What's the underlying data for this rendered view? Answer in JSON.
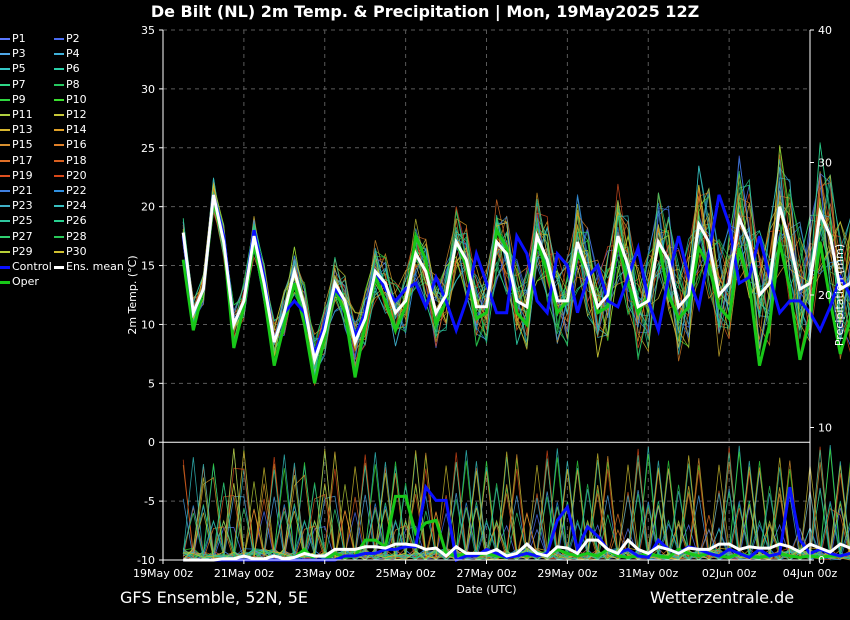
{
  "title": "De Bilt  (NL)  2m Temp. & Precipitation | Mon, 19May2025 12Z",
  "footer_left": "GFS Ensemble, 52N, 5E",
  "footer_right": "Wetterzentrale.de",
  "legend": {
    "members": [
      "P1",
      "P2",
      "P3",
      "P4",
      "P5",
      "P6",
      "P7",
      "P8",
      "P9",
      "P10",
      "P11",
      "P12",
      "P13",
      "P14",
      "P15",
      "P16",
      "P17",
      "P18",
      "P19",
      "P20",
      "P21",
      "P22",
      "P23",
      "P24",
      "P25",
      "P26",
      "P27",
      "P28",
      "P29",
      "P30"
    ],
    "member_colors": [
      "#5a78ff",
      "#4a6cf0",
      "#4fa8e8",
      "#3fb0d8",
      "#35c8c8",
      "#2ad0a8",
      "#2fd888",
      "#26c860",
      "#30d840",
      "#3ce030",
      "#b0d040",
      "#c8c838",
      "#d8b830",
      "#e0a028",
      "#d89030",
      "#e08028",
      "#e07028",
      "#d86020",
      "#e05020",
      "#d84818",
      "#4080e0",
      "#3090e0",
      "#40b0c8",
      "#38c0c0",
      "#30c8a0",
      "#28d090",
      "#30d070",
      "#28c858",
      "#b8d038",
      "#d0c030"
    ],
    "control": "Control",
    "ens_mean": "Ens. mean",
    "oper": "Oper"
  },
  "colors": {
    "control": "#0a10ff",
    "ens_mean": "#ffffff",
    "oper": "#18c818",
    "grid": "#5a5a5a"
  },
  "chart_data": {
    "type": "line",
    "xlabel": "Date (UTC)",
    "ylabel_left": "2m Temp. (°C)",
    "ylabel_right": "Precipitation (mm)",
    "x_ticks": [
      "19May 00z",
      "21May 00z",
      "23May 00z",
      "25May 00z",
      "27May 00z",
      "29May 00z",
      "31May 00z",
      "02Jun 00z",
      "04Jun 00z"
    ],
    "x_range_days": [
      0,
      16
    ],
    "x_start_offset_days": 0.5,
    "step_days": 0.25,
    "ylim_temp": [
      -10,
      35
    ],
    "yticks_temp": [
      -10,
      -5,
      0,
      5,
      10,
      15,
      20,
      25,
      30,
      35
    ],
    "ylim_precip": [
      0,
      40
    ],
    "yticks_precip": [
      0,
      10,
      20,
      30,
      40
    ],
    "grid": true,
    "temp_series": [
      {
        "name": "Control",
        "values": [
          17.5,
          11.0,
          13.0,
          21.0,
          17.5,
          10.0,
          12.0,
          18.0,
          14.0,
          8.5,
          11.0,
          12.0,
          11.0,
          7.5,
          10.0,
          13.0,
          12.0,
          9.0,
          11.0,
          14.5,
          13.0,
          12.0,
          13.0,
          13.5,
          11.5,
          14.0,
          12.0,
          9.5,
          12.0,
          16.0,
          13.5,
          11.0,
          11.0,
          17.5,
          16.0,
          12.0,
          11.0,
          16.0,
          15.0,
          11.0,
          14.0,
          15.0,
          12.0,
          11.5,
          14.0,
          16.5,
          12.0,
          9.5,
          14.0,
          17.5,
          14.0,
          11.5,
          16.0,
          21.0,
          18.5,
          13.5,
          14.0,
          17.5,
          14.0,
          11.0,
          12.0,
          12.0,
          11.0,
          9.5,
          11.5,
          14.0,
          12.5,
          8.0,
          11.0,
          19.0
        ]
      },
      {
        "name": "Ens. mean",
        "values": [
          17.8,
          11.0,
          13.0,
          21.0,
          17.0,
          10.0,
          12.0,
          17.5,
          13.5,
          8.5,
          11.0,
          14.5,
          11.5,
          7.0,
          9.5,
          13.5,
          12.0,
          8.5,
          10.5,
          14.5,
          13.5,
          11.0,
          12.0,
          16.0,
          14.5,
          11.0,
          12.5,
          17.0,
          15.5,
          11.5,
          11.5,
          17.0,
          16.0,
          12.0,
          11.5,
          17.5,
          15.5,
          12.0,
          12.0,
          17.0,
          14.5,
          11.5,
          12.5,
          17.5,
          15.0,
          11.5,
          12.0,
          17.0,
          15.5,
          11.5,
          12.5,
          18.5,
          17.0,
          12.5,
          13.5,
          19.0,
          17.0,
          12.5,
          13.5,
          20.0,
          17.0,
          13.0,
          13.5,
          19.5,
          17.5,
          13.0,
          13.5,
          20.0,
          18.5,
          13.5
        ]
      },
      {
        "name": "Oper",
        "values": [
          15.5,
          9.5,
          13.0,
          20.5,
          17.0,
          8.0,
          11.5,
          17.0,
          12.5,
          6.5,
          10.0,
          13.5,
          10.0,
          5.0,
          9.0,
          13.0,
          11.0,
          5.5,
          10.0,
          14.0,
          12.0,
          9.5,
          11.5,
          17.5,
          15.5,
          10.0,
          12.0,
          17.0,
          15.0,
          10.5,
          11.0,
          18.0,
          16.5,
          11.0,
          10.0,
          17.0,
          14.5,
          11.0,
          12.0,
          16.0,
          14.5,
          11.0,
          11.5,
          17.0,
          13.5,
          11.0,
          12.5,
          17.0,
          12.5,
          10.5,
          11.5,
          16.5,
          15.0,
          11.5,
          10.5,
          16.5,
          13.5,
          6.5,
          10.0,
          17.0,
          13.0,
          7.0,
          10.5,
          17.0,
          12.0,
          7.5,
          10.5,
          16.0,
          12.0,
          20.5
        ]
      }
    ],
    "precip_series": [
      {
        "name": "Control",
        "values": [
          0,
          0,
          0,
          0,
          0,
          0,
          0,
          0,
          0,
          0,
          0,
          0,
          0,
          0,
          0,
          0,
          0.3,
          0.3,
          0.5,
          0.5,
          0.8,
          0.8,
          1.0,
          1.0,
          5.5,
          4.5,
          4.5,
          0,
          0.3,
          0.3,
          0.8,
          0.5,
          0.2,
          0.3,
          0.5,
          0.3,
          0.5,
          3.0,
          4.0,
          0.8,
          2.5,
          1.8,
          0.8,
          0.5,
          0.8,
          0.3,
          0.2,
          1.5,
          0.8,
          0.5,
          1.0,
          0.8,
          0.5,
          0.3,
          0.8,
          0.5,
          0.2,
          0.8,
          0.3,
          0.5,
          5.5,
          1.5,
          0.5,
          0.8,
          0.5,
          0.3,
          0.5,
          0.3,
          0.8,
          0.5
        ]
      },
      {
        "name": "Ens. mean",
        "values": [
          0,
          0,
          0,
          0,
          0.1,
          0.1,
          0.3,
          0.1,
          0.1,
          0.3,
          0.1,
          0.2,
          0.5,
          0.3,
          0.3,
          0.8,
          0.8,
          0.8,
          1.0,
          1.0,
          0.9,
          1.2,
          1.2,
          1.1,
          0.8,
          0.9,
          0.3,
          1.0,
          0.5,
          0.5,
          0.5,
          0.8,
          0.3,
          0.5,
          1.2,
          0.5,
          0.3,
          1.0,
          0.9,
          0.5,
          1.5,
          1.5,
          0.8,
          0.5,
          1.5,
          0.8,
          0.5,
          1.0,
          0.8,
          0.5,
          0.9,
          0.8,
          0.8,
          1.2,
          1.2,
          0.8,
          1.0,
          0.9,
          0.9,
          1.2,
          1.0,
          0.6,
          1.2,
          0.9,
          0.6,
          1.2,
          0.9,
          0.7,
          0.9,
          0.8
        ]
      },
      {
        "name": "Oper",
        "values": [
          0,
          0,
          0,
          0,
          0,
          0,
          0,
          0,
          0,
          0,
          0,
          0.2,
          0.8,
          0,
          0,
          0.5,
          0.2,
          0.3,
          1.5,
          1.5,
          1.0,
          4.8,
          4.8,
          2.0,
          2.8,
          3.0,
          0.5,
          0.3,
          0.5,
          0.3,
          0.5,
          0.3,
          0.2,
          0.5,
          0.3,
          0.5,
          0.3,
          0.8,
          0.5,
          0.3,
          0.5,
          0.3,
          0.8,
          0.3,
          0.2,
          0.3,
          0.5,
          0.3,
          0.2,
          0.8,
          0.5,
          0.3,
          0.5,
          0.3,
          0.2,
          0.5,
          0.3,
          0.2,
          0.3,
          0.5,
          0.3,
          0.2,
          0.3,
          0.2,
          0.3,
          0.3,
          0.5,
          0.3,
          0.2,
          0.5
        ]
      }
    ]
  }
}
